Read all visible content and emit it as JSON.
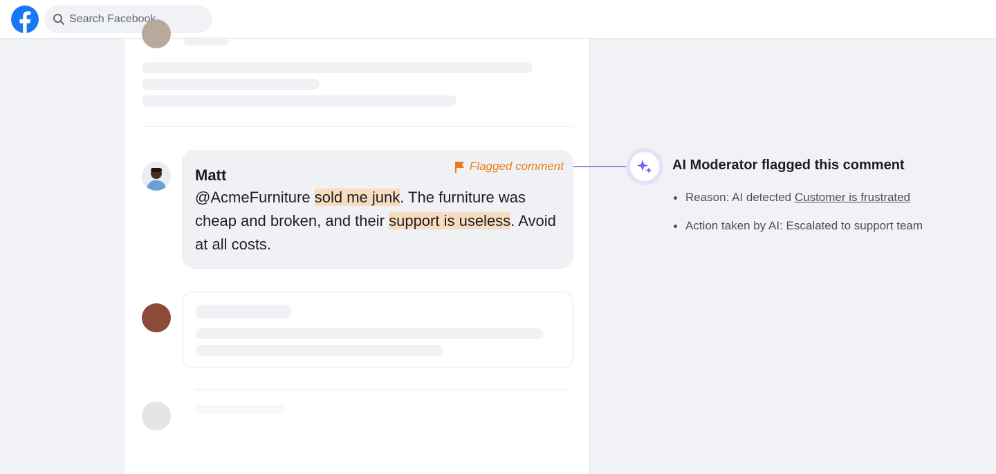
{
  "header": {
    "logo_icon": "facebook-logo-icon",
    "search": {
      "placeholder": "Search Facebook",
      "icon": "search-icon"
    }
  },
  "comment": {
    "author": "Matt",
    "text_segments": [
      {
        "text": "@AcmeFurniture ",
        "highlight": false
      },
      {
        "text": "sold me junk",
        "highlight": true
      },
      {
        "text": ". The furniture was cheap and broken, and their ",
        "highlight": false
      },
      {
        "text": "support is useless",
        "highlight": true
      },
      {
        "text": ". Avoid at all costs.",
        "highlight": false
      }
    ],
    "flag": {
      "label": "Flagged comment",
      "icon": "flag-icon",
      "color": "#ee7a15"
    },
    "highlight_color": "#f7dcc0"
  },
  "ai_moderator": {
    "icon": "sparkle-icon",
    "accent_color": "#7b5cf0",
    "title": "AI Moderator flagged this comment",
    "reason_prefix": "Reason: AI detected ",
    "reason_link": "Customer is frustrated",
    "action": "Action taken by AI: Escalated to support team"
  }
}
